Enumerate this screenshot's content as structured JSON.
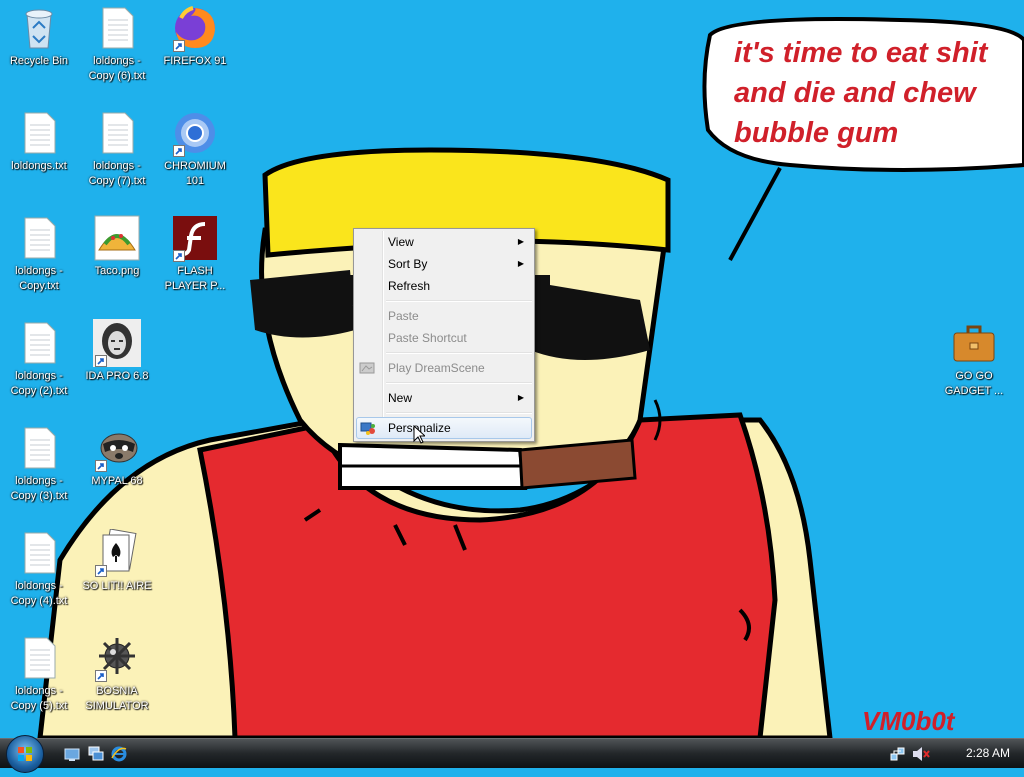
{
  "desktop": {
    "icons": [
      {
        "label": "Recycle Bin",
        "icon": "recycle-bin-icon"
      },
      {
        "label": "loldongs - Copy (6).txt",
        "icon": "text-file-icon"
      },
      {
        "label": "FIREFOX 91",
        "icon": "firefox-icon"
      },
      {
        "label": "loldongs.txt",
        "icon": "text-file-icon"
      },
      {
        "label": "loldongs - Copy (7).txt",
        "icon": "text-file-icon"
      },
      {
        "label": "CHROMIUM 101",
        "icon": "chromium-icon"
      },
      {
        "label": "loldongs - Copy.txt",
        "icon": "text-file-icon"
      },
      {
        "label": "Taco.png",
        "icon": "taco-image-icon"
      },
      {
        "label": "FLASH PLAYER P...",
        "icon": "flash-player-icon"
      },
      {
        "label": "loldongs - Copy (2).txt",
        "icon": "text-file-icon"
      },
      {
        "label": "IDA PRO 6.8",
        "icon": "ida-pro-icon"
      },
      {
        "label": "loldongs - Copy (3).txt",
        "icon": "text-file-icon"
      },
      {
        "label": "MYPAL 68",
        "icon": "raccoon-icon"
      },
      {
        "label": "loldongs - Copy (4).txt",
        "icon": "text-file-icon"
      },
      {
        "label": "SO LIT!! AIRE",
        "icon": "solitaire-icon"
      },
      {
        "label": "loldongs - Copy (5).txt",
        "icon": "text-file-icon"
      },
      {
        "label": "BOSNIA SIMULATOR",
        "icon": "mine-icon"
      },
      {
        "label": "GO GO GADGET ...",
        "icon": "briefcase-icon"
      }
    ]
  },
  "wallpaper": {
    "speech_lines": [
      "it's time to eat shit",
      "and die and chew",
      "bubble gum"
    ],
    "signature": "VM0b0t",
    "colors": {
      "sky": "#1fb1ec",
      "shirt": "#e52a2f",
      "skin": "#fbf2b8",
      "hair": "#fae51c",
      "text": "#d0202a"
    }
  },
  "context_menu": {
    "items": [
      {
        "label": "View",
        "submenu": true,
        "enabled": true
      },
      {
        "label": "Sort By",
        "submenu": true,
        "enabled": true
      },
      {
        "label": "Refresh",
        "submenu": false,
        "enabled": true
      },
      {
        "label": "Paste",
        "submenu": false,
        "enabled": false
      },
      {
        "label": "Paste Shortcut",
        "submenu": false,
        "enabled": false
      },
      {
        "label": "Play DreamScene",
        "submenu": false,
        "enabled": false
      },
      {
        "label": "New",
        "submenu": true,
        "enabled": true
      },
      {
        "label": "Personalize",
        "submenu": false,
        "enabled": true,
        "highlighted": true
      }
    ]
  },
  "taskbar": {
    "start_icon": "windows-orb-icon",
    "quick_launch": [
      "show-desktop-icon",
      "switch-windows-icon",
      "internet-explorer-icon"
    ],
    "tray_icons": [
      "network-icon",
      "volume-muted-icon"
    ],
    "clock": "2:28 AM"
  }
}
